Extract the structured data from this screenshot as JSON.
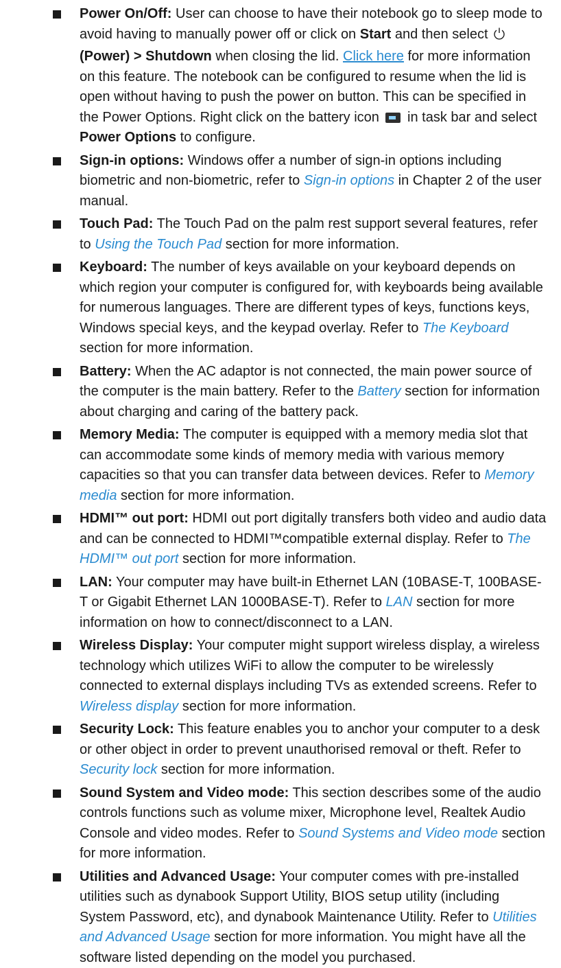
{
  "items": [
    {
      "term": "Power On/Off:",
      "t1": " User can choose to have their notebook go to sleep mode to avoid having to manually power off or click on ",
      "b1": "Start",
      "t2": " and then select ",
      "power_icon": "power-icon",
      "b2": "(Power) > Shutdown",
      "t3": " when closing the lid. ",
      "link": "Click here",
      "t4": " for more information on this feature. The notebook can be configured to resume when the lid is open without having to push the power on button. This can be specified in the Power Options. Right click on the battery icon ",
      "battery_icon": "battery-icon",
      "t5": " in task bar and select ",
      "b3": "Power Options",
      "t6": " to configure."
    },
    {
      "term": "Sign-in options:",
      "before": " Windows offer a number of sign-in options including biometric and non-biometric, refer to ",
      "xref": "Sign-in options",
      "after": " in Chapter 2 of the user manual."
    },
    {
      "term": "Touch Pad:",
      "before": " The Touch Pad on the palm rest support several features, refer to ",
      "xref": "Using the Touch Pad",
      "after": " section for more information."
    },
    {
      "term": "Keyboard:",
      "before": " The number of keys available on your keyboard depends on which region your computer is configured for, with keyboards being available for numerous languages. There are different types of keys, functions keys, Windows special keys, and the keypad overlay. Refer to ",
      "xref": "The Keyboard",
      "after": " section for more information."
    },
    {
      "term": "Battery:",
      "before": " When the AC adaptor is not connected, the main power source of the computer is the main battery. Refer to the ",
      "xref": "Battery",
      "after": " section for information about charging and caring of the battery pack."
    },
    {
      "term": "Memory Media:",
      "before": " The computer is equipped with a memory media slot that can accommodate some kinds of memory media with various memory capacities so that you can transfer data between devices. Refer to ",
      "xref": "Memory media",
      "after": " section for more information."
    },
    {
      "term": "HDMI™ out port:",
      "before": " HDMI out port digitally transfers both video and audio data and can be connected to HDMI™compatible external display. Refer to ",
      "xref": "The HDMI™ out port",
      "after": " section for more information."
    },
    {
      "term": "LAN:",
      "before": " Your computer may have built-in Ethernet LAN (10BASE-T, 100BASE-T or Gigabit Ethernet LAN 1000BASE-T). Refer to ",
      "xref": "LAN",
      "after": " section for more information on how to connect/disconnect to a LAN."
    },
    {
      "term": "Wireless Display:",
      "before": " Your computer might support wireless display, a wireless technology which utilizes WiFi to allow the computer to be wirelessly connected to external displays including TVs as extended screens. Refer to ",
      "xref": "Wireless display",
      "after": " section for more information."
    },
    {
      "term": "Security Lock:",
      "before": " This feature enables you to anchor your computer to a desk or other object in order to prevent unauthorised removal or theft. Refer to ",
      "xref": "Security lock",
      "after": " section for more information."
    },
    {
      "term": "Sound System and Video mode:",
      "before": " This section describes some of the audio controls functions such as volume mixer, Microphone level, Realtek Audio Console and video modes. Refer to ",
      "xref": "Sound Systems and Video mode",
      "after": " section for more information."
    },
    {
      "term": "Utilities and Advanced Usage:",
      "before": " Your computer comes with pre-installed utilities such as dynabook Support Utility, BIOS setup utility (including System Password, etc), and dynabook Maintenance Utility. Refer to ",
      "xref": "Utilities and Advanced Usage",
      "after": " section for more information. You might have all the software listed depending on the model you purchased."
    }
  ]
}
